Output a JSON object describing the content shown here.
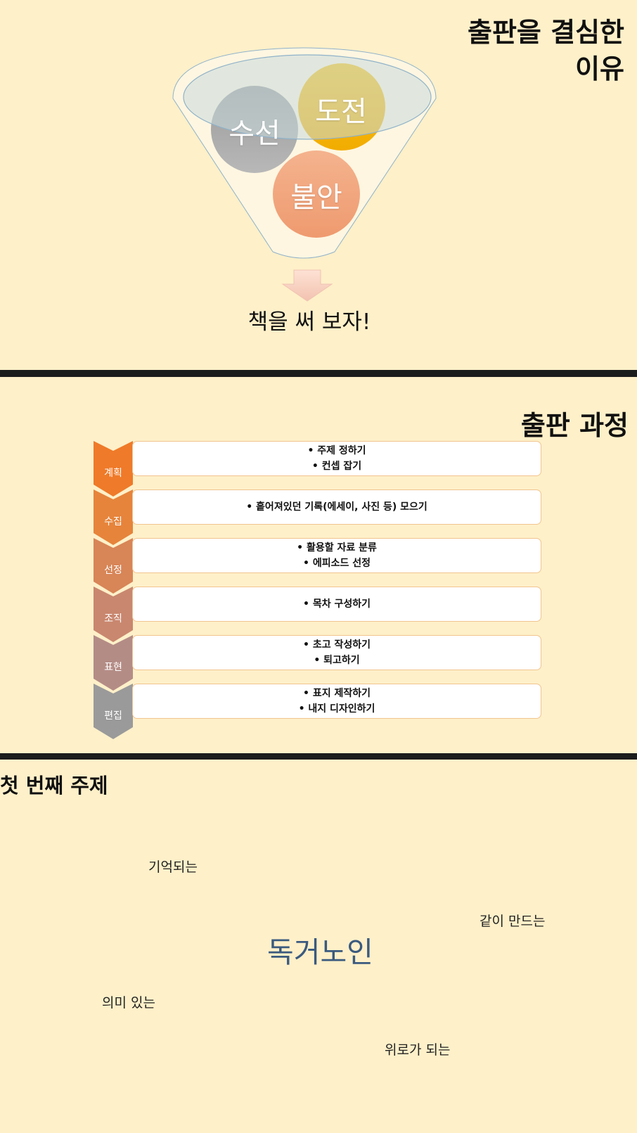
{
  "slide1": {
    "title_line1": "출판을 결심한",
    "title_line2": "이유",
    "circles": [
      "수선",
      "도전",
      "불안"
    ],
    "result": "책을 써 보자!",
    "colors": {
      "gray": "#a3a3a3",
      "gold": "#f7b800",
      "salmon": "#f2a57c"
    }
  },
  "slide2": {
    "title": "출판 과정",
    "steps": [
      {
        "label": "계획",
        "lines": [
          "• 주제 정하기",
          "• 컨셉 잡기"
        ],
        "color": "#ef7a29"
      },
      {
        "label": "수집",
        "lines": [
          "• 흩어져있던 기록(에세이, 사진 등) 모으기"
        ],
        "color": "#e6843b"
      },
      {
        "label": "선정",
        "lines": [
          "• 활용할 자료 분류",
          "• 에피소드 선정"
        ],
        "color": "#d88557"
      },
      {
        "label": "조직",
        "lines": [
          "• 목차 구성하기"
        ],
        "color": "#c9876f"
      },
      {
        "label": "표현",
        "lines": [
          "• 초고 작성하기",
          "• 퇴고하기"
        ],
        "color": "#b48c86"
      },
      {
        "label": "편집",
        "lines": [
          "• 표지 제작하기",
          "• 내지 디자인하기"
        ],
        "color": "#9a9a9a"
      }
    ]
  },
  "slide3": {
    "title": "첫 번째 주제",
    "center_word": "독거노인",
    "words": [
      "기억되는",
      "같이 만드는",
      "의미 있는",
      "위로가 되는"
    ]
  }
}
